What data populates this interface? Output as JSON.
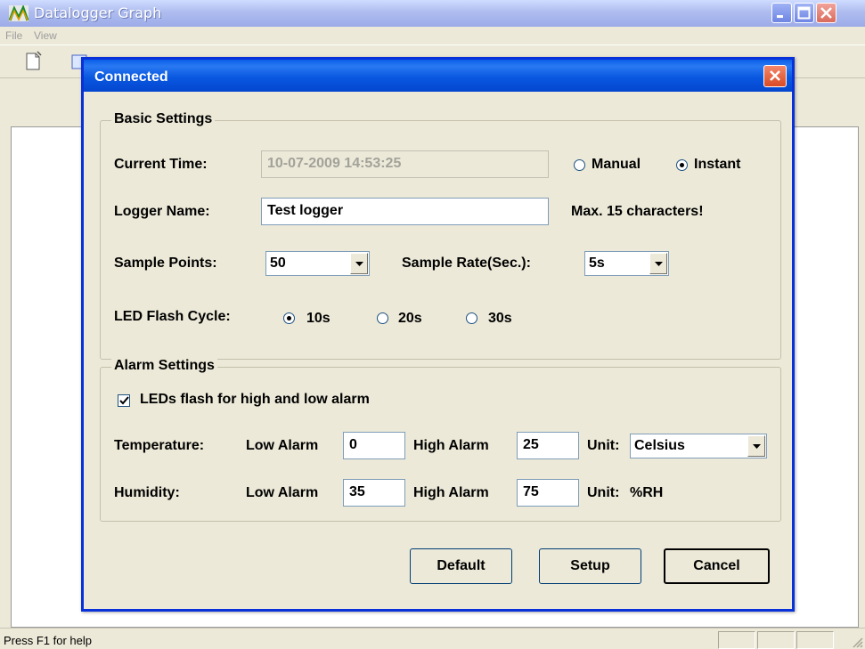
{
  "app": {
    "title": "Datalogger Graph",
    "menu": [
      "File",
      "View"
    ],
    "status_text": "Press F1 for help"
  },
  "dialog": {
    "title": "Connected",
    "basic": {
      "group_label": "Basic Settings",
      "current_time_label": "Current Time:",
      "current_time_value": "10-07-2009 14:53:25",
      "manual_label": "Manual",
      "instant_label": "Instant",
      "time_mode_selected": "Instant",
      "logger_name_label": "Logger Name:",
      "logger_name_value": "Test logger",
      "logger_name_hint": "Max. 15 characters!",
      "sample_points_label": "Sample Points:",
      "sample_points_value": "50",
      "sample_rate_label": "Sample Rate(Sec.):",
      "sample_rate_value": "5s",
      "led_cycle_label": "LED Flash Cycle:",
      "led_options": [
        "10s",
        "20s",
        "30s"
      ],
      "led_selected": "10s"
    },
    "alarm": {
      "group_label": "Alarm Settings",
      "led_flash_label": "LEDs flash for high and low alarm",
      "led_flash_checked": true,
      "temperature_label": "Temperature:",
      "humidity_label": "Humidity:",
      "low_alarm_label": "Low Alarm",
      "high_alarm_label": "High Alarm",
      "unit_label": "Unit:",
      "temp_low": "0",
      "temp_high": "25",
      "temp_unit": "Celsius",
      "humidity_low": "35",
      "humidity_high": "75",
      "humidity_unit": "%RH"
    },
    "buttons": {
      "default": "Default",
      "setup": "Setup",
      "cancel": "Cancel"
    }
  },
  "colors": {
    "dialog_title_blue": "#0a58e0",
    "face": "#ece9d8",
    "close_red": "#d94a26"
  }
}
